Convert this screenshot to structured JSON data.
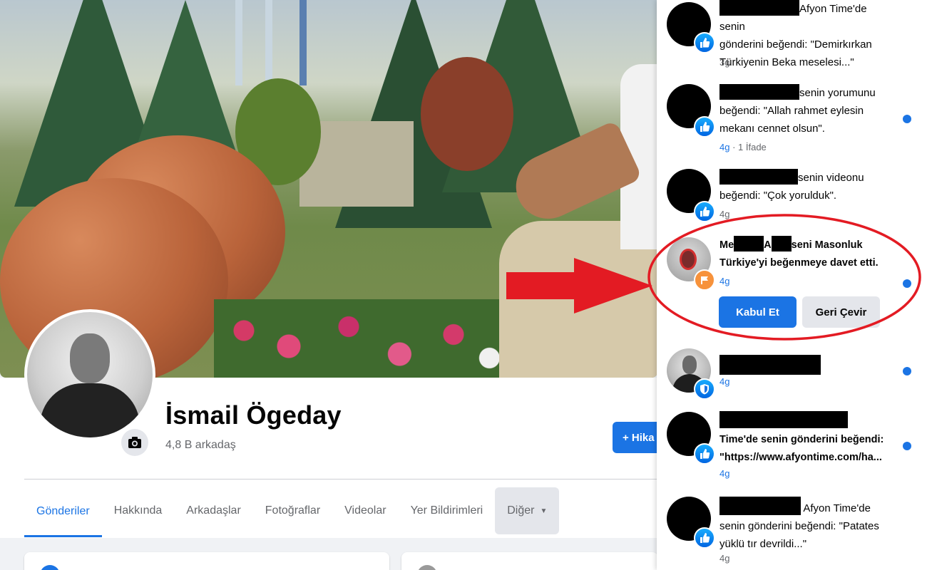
{
  "colors": {
    "fb_blue": "#1b74e4",
    "highlight_red": "#e31b23",
    "unread_dot": "#1b74e4"
  },
  "profile": {
    "name": "İsmail Ögeday",
    "friends": "4,8 B arkadaş",
    "story_button": "+ Hika",
    "camera_icon": "camera-icon"
  },
  "tabs": {
    "items": [
      {
        "label": "Gönderiler"
      },
      {
        "label": "Hakkında"
      },
      {
        "label": "Arkadaşlar"
      },
      {
        "label": "Fotoğraflar"
      },
      {
        "label": "Videolar"
      },
      {
        "label": "Yer Bildirimleri"
      },
      {
        "label": "Diğer"
      }
    ]
  },
  "notifications": [
    {
      "line1": "Afyon Time'de senin",
      "line2": "gönderini beğendi: \"Demirkırkan",
      "line3": "Türkiyenin Beka meselesi...\"",
      "time": "3g",
      "badge": "like-icon"
    },
    {
      "line1": "senin yorumunu",
      "line2": "beğendi: \"Allah rahmet eylesin",
      "line3": "mekanı cennet olsun\".",
      "time": "4g",
      "reactions": " · 1 İfade",
      "badge": "like-icon",
      "unread": true
    },
    {
      "line1": "senin videonu",
      "line2": "beğendi: \"Çok yorulduk\".",
      "time": "4g",
      "badge": "like-icon"
    },
    {
      "prefix1": "Me",
      "prefix2": "A",
      "line1": "seni Masonluk",
      "line2": "Türkiye'yi beğenmeye davet etti.",
      "time": "4g",
      "badge": "page-icon",
      "unread": true,
      "accept": "Kabul Et",
      "decline": "Geri Çevir"
    },
    {
      "time": "4g",
      "badge": "shield-icon",
      "unread": true
    },
    {
      "line1": "Time'de senin gönderini beğendi:",
      "line2": "\"https://www.afyontime.com/ha...",
      "time": "4g",
      "badge": "like-icon",
      "unread": true
    },
    {
      "line1": "Afyon Time'de",
      "line2": "senin gönderini beğendi: \"Patates",
      "line3": "yüklü tır devrildi...\"",
      "time": "4g",
      "badge": "like-icon"
    }
  ]
}
